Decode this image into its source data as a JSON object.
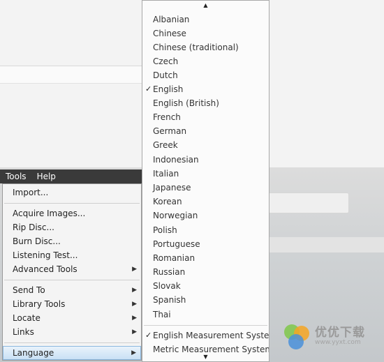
{
  "menubar": {
    "items": [
      "Tools",
      "Help"
    ]
  },
  "tools_menu": {
    "items": [
      {
        "label": "Import...",
        "submenu": false
      },
      {
        "label": "Acquire Images...",
        "submenu": false
      },
      {
        "label": "Rip Disc...",
        "submenu": false
      },
      {
        "label": "Burn Disc...",
        "submenu": false
      },
      {
        "label": "Listening Test...",
        "submenu": false
      },
      {
        "label": "Advanced Tools",
        "submenu": true
      },
      {
        "label": "Send To",
        "submenu": true
      },
      {
        "label": "Library Tools",
        "submenu": true
      },
      {
        "label": "Locate",
        "submenu": true
      },
      {
        "label": "Links",
        "submenu": true
      },
      {
        "label": "Language",
        "submenu": true,
        "highlighted": true
      }
    ]
  },
  "language_submenu": {
    "scroll_up_icon": "triangle-up",
    "scroll_down_icon": "triangle-down",
    "languages": [
      "Albanian",
      "Chinese",
      "Chinese (traditional)",
      "Czech",
      "Dutch",
      "English",
      "English (British)",
      "French",
      "German",
      "Greek",
      "Indonesian",
      "Italian",
      "Japanese",
      "Korean",
      "Norwegian",
      "Polish",
      "Portuguese",
      "Romanian",
      "Russian",
      "Slovak",
      "Spanish",
      "Thai"
    ],
    "selected_language": "English",
    "measurement_systems": [
      "English Measurement System",
      "Metric Measurement System"
    ],
    "selected_measurement": "English Measurement System"
  },
  "watermark": {
    "title": "优优下载",
    "url": "www.yyxt.com"
  }
}
